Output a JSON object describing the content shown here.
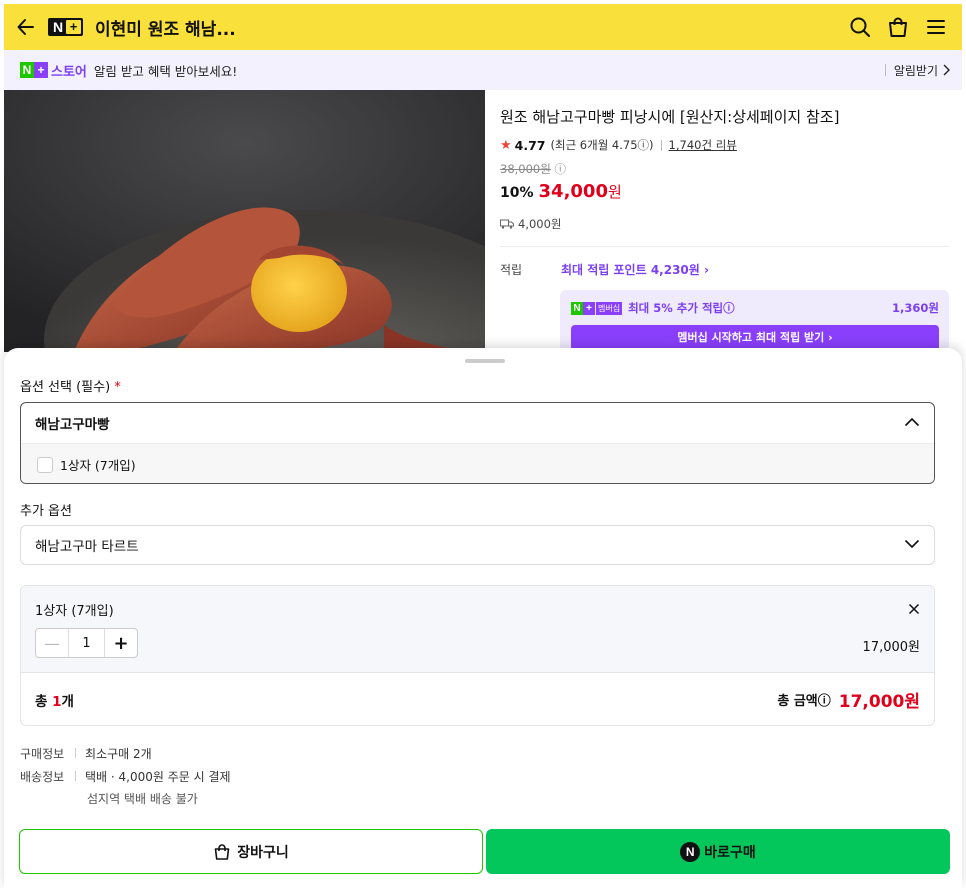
{
  "header": {
    "title": "이현미 원조 해남...",
    "logo": {
      "n": "N",
      "plus": "+"
    },
    "bg_color": "#f9e03a"
  },
  "notify": {
    "logo": {
      "n": "N",
      "plus": "+"
    },
    "store": "스토어",
    "message": "알림 받고 혜택 받아보세요!",
    "action": "알림받기"
  },
  "product": {
    "title": "원조 해남고구마빵 피낭시에 [원산지:상세페이지 참조]",
    "rating": "4.77",
    "recent_rating": "(최근 6개월 4.75ⓘ)",
    "reviews": "1,740건 리뷰",
    "original_price": "38,000원",
    "discount": "10%",
    "price": "34,000",
    "price_unit": "원",
    "shipping": "4,000원",
    "points_label": "적립",
    "points_max": "최대 적립 포인트 4,230원 ›",
    "membership": {
      "badge": "멤버십",
      "extra": "최대 5% 추가 적립ⓘ",
      "amount": "1,360원",
      "cta": "멤버십 시작하고 최대 적립 받기 ›"
    }
  },
  "sheet": {
    "option_label": "옵션 선택 (필수)",
    "required_mark": "*",
    "option_head": "해남고구마빵",
    "option_item": "1상자 (7개입)",
    "additional_label": "추가 옵션",
    "additional_value": "해남고구마 타르트",
    "cart_item": {
      "name": "1상자 (7개입)",
      "minus": "—",
      "qty": "1",
      "plus": "+",
      "price": "17,000원"
    },
    "total": {
      "prefix": "총 ",
      "count": "1",
      "suffix": "개",
      "label": "총 금액ⓘ",
      "amount": "17,000원"
    },
    "purchase_info": {
      "key": "구매정보",
      "value": "최소구매 2개"
    },
    "shipping_info": {
      "key": "배송정보",
      "value": "택배 · 4,000원 주문 시 결제",
      "note": "섬지역 택배 배송 불가"
    },
    "cart_button": "장바구니",
    "buy_button": "바로구매",
    "buy_logo": "N"
  },
  "colors": {
    "accent_red": "#e0001b",
    "accent_purple": "#8a3ffc",
    "naver_green": "#03c75a"
  }
}
